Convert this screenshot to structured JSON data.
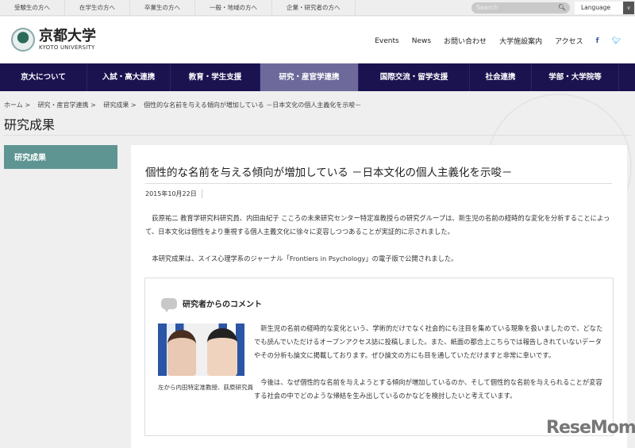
{
  "topbar": {
    "links": [
      "受験生の方へ",
      "在学生の方へ",
      "卒業生の方へ",
      "一般・地域の方へ",
      "企業・研究者の方へ"
    ],
    "search_placeholder": "Search",
    "language": "Language"
  },
  "header": {
    "logo_jp": "京都大学",
    "logo_en": "KYOTO UNIVERSITY",
    "links": [
      "Events",
      "News",
      "お問い合わせ",
      "大学施設案内",
      "アクセス"
    ],
    "facebook": "f",
    "twitter": "🐦"
  },
  "mainnav": [
    "京大について",
    "入試・高大連携",
    "教育・学生支援",
    "研究・産官学連携",
    "国際交流・留学支援",
    "社会連携",
    "学部・大学院等"
  ],
  "breadcrumb": [
    "ホーム",
    ">",
    "研究・産官学連携",
    ">",
    "研究成果",
    ">",
    "個性的な名前を与える傾向が増加している －日本文化の個人主義化を示唆－"
  ],
  "page_title": "研究成果",
  "sidebar": {
    "item": "研究成果"
  },
  "article": {
    "title": "個性的な名前を与える傾向が増加している －日本文化の個人主義化を示唆－",
    "date": "2015年10月22日",
    "p1": "　荻原祐二 教育学研究科研究員、内田由紀子 こころの未来研究センター特定准教授らの研究グループは、新生児の名前の経時的な変化を分析することによって、日本文化は個性をより重視する個人主義文化に徐々に変容しつつあることが実証的に示されました。",
    "p2": "　本研究成果は、スイス心理学系のジャーナル「Frontiers in Psychology」の電子版で公開されました。",
    "comment": {
      "heading": "研究者からのコメント",
      "caption": "左から内田特定准教授、荻原研究員",
      "c1": "新生児の名前の経時的な変化という、学術的だけでなく社会的にも注目を集めている現象を扱いましたので、どなたでも読んでいただけるオープンアクセス誌に投稿しました。また、紙面の都合上こちらでは報告しきれていないデータやその分析も論文に掲載しております。ぜひ論文の方にも目を通していただけますと非常に幸いです。",
      "c2": "今後は、なぜ個性的な名前を与えようとする傾向が増加しているのか、そして個性的な名前を与えられることが変容する社会の中でどのような帰結を生み出しているのかなどを検討したいと考えています。"
    }
  },
  "watermark": "ReseMom"
}
